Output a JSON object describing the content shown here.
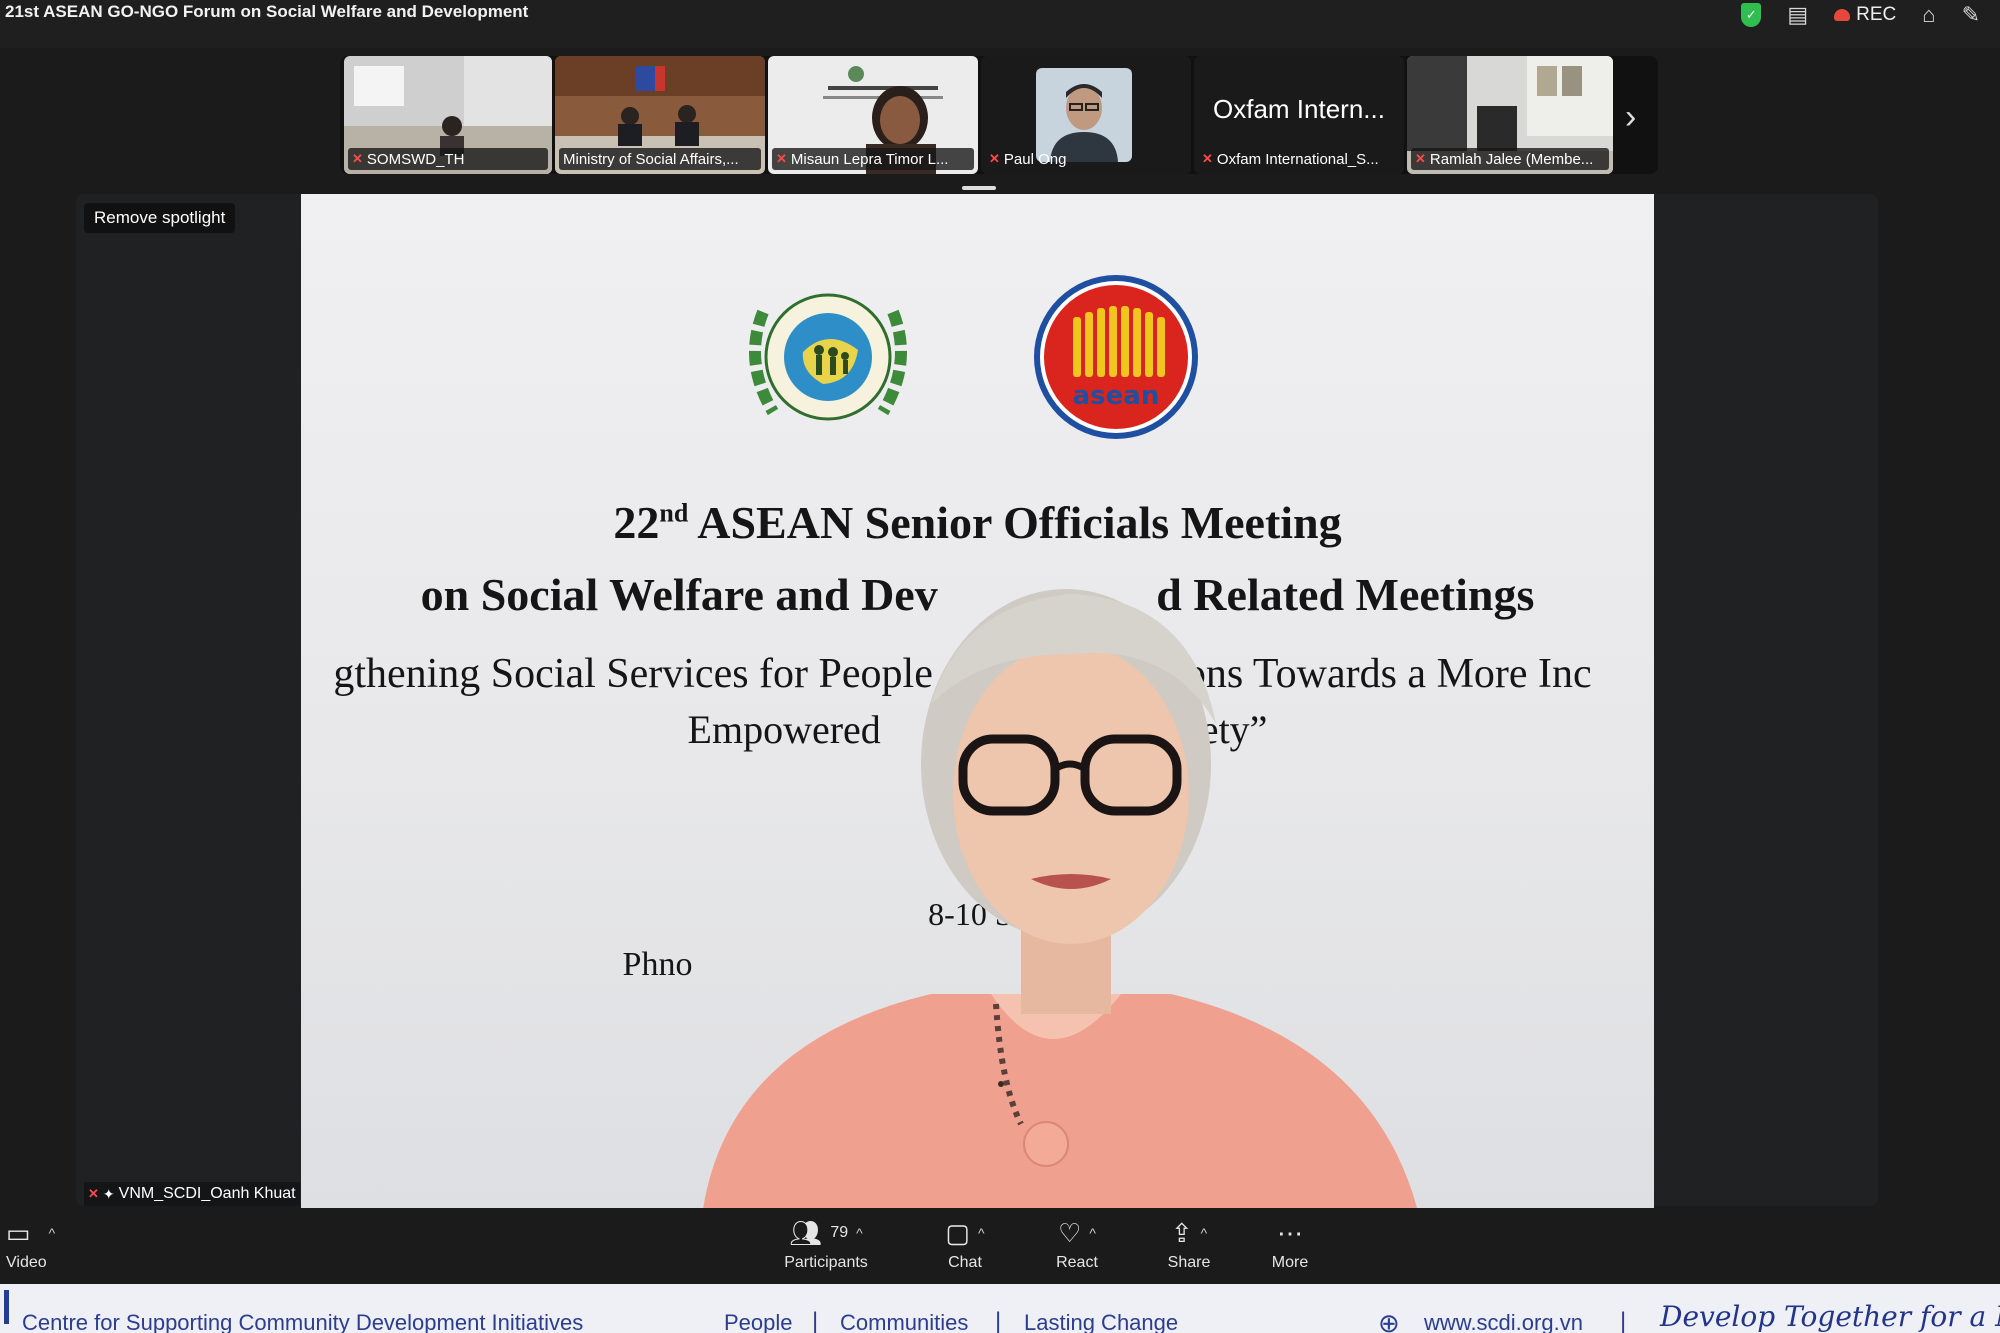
{
  "window": {
    "title": "21st ASEAN GO-NGO Forum on Social Welfare and Development"
  },
  "top_right": {
    "rec_label": "REC",
    "icons": [
      "shield-check-icon",
      "transcript-icon",
      "record-cloud-icon",
      "person-frame-icon",
      "pencil-icon"
    ]
  },
  "thumbnails": [
    {
      "name": "SOMSWD_TH",
      "muted": true
    },
    {
      "name": "Ministry of Social Affairs,...",
      "muted": false
    },
    {
      "name": "Misaun Lepra Timor L...",
      "muted": true
    },
    {
      "name": "Paul Ong",
      "muted": true
    },
    {
      "name": "Oxfam International_S...",
      "muted": true,
      "display_text": "Oxfam Intern..."
    },
    {
      "name": "Ramlah Jalee (Membe...",
      "muted": true
    }
  ],
  "spotlight": {
    "remove_label": "Remove spotlight"
  },
  "banner": {
    "line1_num": "22",
    "line1_sup": "nd",
    "line1_rest": " ASEAN Senior Officials Meeting",
    "line2": "on Social Welfare and Dev                   d Related Meetings",
    "line3": "gthening Social Services for People                    ations Towards a More Inc",
    "line4": "Empowered                                ety”",
    "line5": "8-10 Se",
    "line6": "Phno"
  },
  "active_speaker": {
    "name": "VNM_SCDI_Oanh Khuat"
  },
  "toolbar": {
    "video_label": "Video",
    "participants_label": "Participants",
    "participants_count": "79",
    "chat_label": "Chat",
    "react_label": "React",
    "share_label": "Share",
    "more_label": "More"
  },
  "footer": {
    "org": "Centre for Supporting Community Development Initiatives",
    "item1": "People",
    "item2": "Communities",
    "item3": "Lasting Change",
    "website": "www.scdi.org.vn",
    "slogan": "Develop Together for a More Inclus"
  },
  "colors": {
    "mic_off": "#ff4a4a",
    "rec": "#e6483e",
    "shield": "#2fbf4f",
    "footer_blue": "#2b3d8f",
    "blazer": "#f0a08e"
  }
}
